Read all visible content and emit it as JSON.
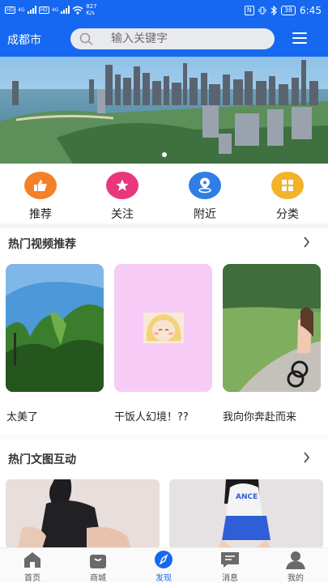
{
  "status_bar": {
    "hd1": "HD",
    "net1": "4G",
    "hd2": "HD",
    "net2": "4G",
    "speed_value": "827",
    "speed_unit": "K/s",
    "nfc": "N",
    "battery": "38",
    "time": "6:45"
  },
  "header": {
    "city": "成都市",
    "search_placeholder": "输入关键字"
  },
  "categories": [
    {
      "label": "推荐",
      "color": "#f5802a"
    },
    {
      "label": "关注",
      "color": "#e8377e"
    },
    {
      "label": "附近",
      "color": "#2f7ee5"
    },
    {
      "label": "分类",
      "color": "#f3b22a"
    }
  ],
  "hot_videos": {
    "title": "热门视频推荐",
    "items": [
      {
        "caption": "太美了"
      },
      {
        "caption": "干饭人幻境！??"
      },
      {
        "caption": "我向你奔赴而来"
      }
    ]
  },
  "hot_posts": {
    "title": "热门文图互动"
  },
  "bottom_nav": [
    {
      "label": "首页"
    },
    {
      "label": "商城"
    },
    {
      "label": "发现"
    },
    {
      "label": "消息"
    },
    {
      "label": "我的"
    }
  ],
  "colors": {
    "brand": "#1668f0",
    "nav_active": "#1668f0"
  }
}
